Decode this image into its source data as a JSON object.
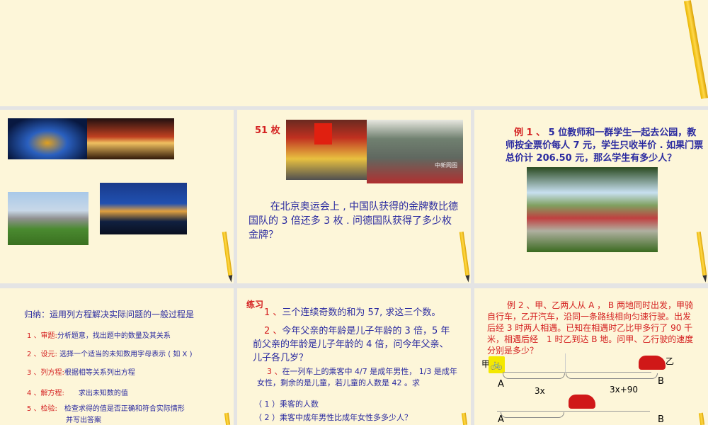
{
  "slide2": {
    "label": "51 枚",
    "problem": "在北京奥运会上 , 中国队获得的金牌数比德国队的 3 倍还多 3 枚 . 问德国队获得了多少枚金牌？",
    "watermark": "中新网图"
  },
  "slide3": {
    "label": "例 1 、",
    "problem": "5 位教师和一群学生一起去公园，教师按全票价每人 7 元，学生只收半价 . 如果门票总价计 206.50 元，那么学生有多少人？"
  },
  "slide4": {
    "title": "归纳：运用列方程解决实际问题的一般过程是",
    "steps": [
      {
        "n": "1 、审题:",
        "d": "分析题意，找出题中的数量及其关系"
      },
      {
        "n": "2 、设元:",
        "d": "选择一个适当的未知数用字母表示 ( 如 X )"
      },
      {
        "n": "3 、列方程:",
        "d": "根据相等关系列出方程"
      },
      {
        "n": "4 、解方程:",
        "d": "求出未知数的值"
      },
      {
        "n": "5 、检验:",
        "d": "检查求得的值是否正确和符合实际情形"
      }
    ],
    "cut": "并写出答案"
  },
  "slide5": {
    "title": "练习",
    "q1n": "1 、",
    "q1": "三个连续奇数的和为 57, 求这三个数。",
    "q2n": "2 、",
    "q2": "今年父亲的年龄是儿子年龄的 3 倍，5 年前父亲的年龄是儿子年龄的 4 倍，问今年父亲、儿子各几岁？",
    "q3n": "3 、",
    "q3": "在一列车上的乘客中 4/7 是成年男性， 1/3 是成年女性，剩余的是儿童，若儿童的人数是 42 。求",
    "q3a": "（ 1 ）乘客的人数",
    "q3b": "（ 2 ）乘客中成年男性比成年女性多多少人？"
  },
  "slide6": {
    "problem": "例 2 、甲、乙两人从 A ， B 两地同时出发，甲骑自行车，乙开汽车，沿同一条路线相向匀速行驶。出发后经 3 时两人相遇。已知在相遇时乙比甲多行了 90 千米，相遇后经　1 时乙到达 B 地。问甲、乙行驶的速度分别是多少？",
    "jia": "甲",
    "yi": "乙",
    "A": "A",
    "B": "B",
    "seg1": "3x",
    "seg2": "3x+90",
    "A2": "A",
    "B2": "B"
  }
}
